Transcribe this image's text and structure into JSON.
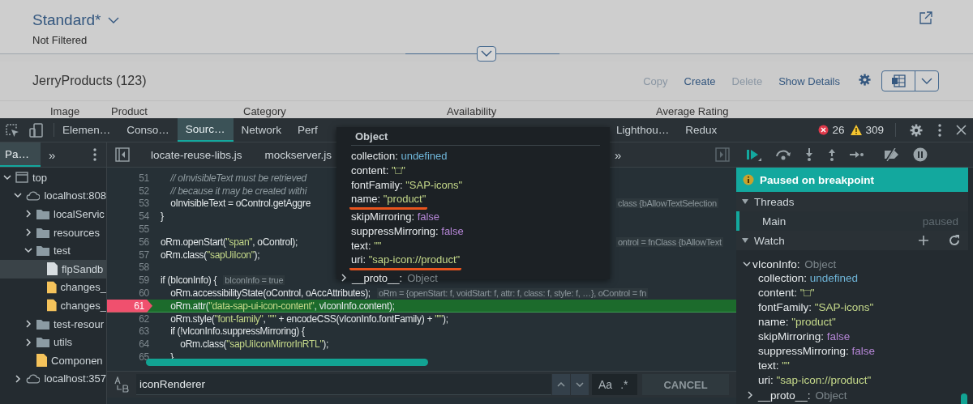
{
  "page": {
    "variant_title": "Standard*",
    "filter_status": "Not Filtered",
    "table_title": "JerryProducts (123)",
    "actions": [
      {
        "label": "Copy",
        "disabled": true
      },
      {
        "label": "Create",
        "disabled": false
      },
      {
        "label": "Delete",
        "disabled": true
      },
      {
        "label": "Show Details",
        "disabled": false
      }
    ],
    "columns": [
      "Image",
      "Product",
      "Category",
      "Availability",
      "Average Rating"
    ]
  },
  "devtools": {
    "tabs": [
      {
        "label": "Elemen…",
        "selected": false
      },
      {
        "label": "Conso…",
        "selected": false
      },
      {
        "label": "Sourc…",
        "selected": true
      },
      {
        "label": "Network",
        "selected": false
      },
      {
        "label": "Perf",
        "selected": false
      },
      {
        "label": "Lighthou…",
        "selected": false
      },
      {
        "label": "Redux",
        "selected": false
      }
    ],
    "errors": "26",
    "warnings": "309",
    "navigator": {
      "tab": {
        "label": "Pa…",
        "selected": true
      },
      "more": "»",
      "tree": [
        {
          "label": "top",
          "kind": "frame",
          "expanded": true,
          "selected": false,
          "children": [
            {
              "label": "localhost:808",
              "kind": "origin",
              "expanded": true,
              "selected": false,
              "children": [
                {
                  "label": "localServic",
                  "kind": "folder",
                  "expanded": false,
                  "selected": false
                },
                {
                  "label": "resources",
                  "kind": "folder",
                  "expanded": false,
                  "selected": false
                },
                {
                  "label": "test",
                  "kind": "folder",
                  "expanded": true,
                  "selected": false,
                  "children": [
                    {
                      "label": "flpSandb",
                      "kind": "file",
                      "selected": true
                    },
                    {
                      "label": "changes_",
                      "kind": "script",
                      "selected": false
                    },
                    {
                      "label": "changes_",
                      "kind": "script",
                      "selected": false
                    }
                  ]
                },
                {
                  "label": "test-resour",
                  "kind": "folder",
                  "expanded": false,
                  "selected": false
                },
                {
                  "label": "utils",
                  "kind": "folder",
                  "expanded": false,
                  "selected": false
                },
                {
                  "label": "Componen",
                  "kind": "script",
                  "selected": false
                }
              ]
            },
            {
              "label": "localhost:357",
              "kind": "origin",
              "expanded": false,
              "selected": false
            }
          ]
        }
      ]
    },
    "files": [
      "locate-reuse-libs.js",
      "mockserver.js"
    ],
    "files_more": "»",
    "code": [
      {
        "number": "51",
        "kind": "comment",
        "text": "    // oInvisibleText must be retrieved",
        "paused": false
      },
      {
        "number": "52",
        "kind": "comment",
        "text": "    // because it may be created withi",
        "paused": false
      },
      {
        "number": "53",
        "kind": "code",
        "text": "    oInvisibleText = oControl.getAggre",
        "hint": {
          "text": "class {bAllowTextSelection",
          "kind": "far"
        },
        "paused": false
      },
      {
        "number": "54",
        "kind": "code",
        "text": "}",
        "paused": false
      },
      {
        "number": "55",
        "paused": false
      },
      {
        "number": "56",
        "kind": "code",
        "text": "oRm.openStart(\"span\", oControl);",
        "hint": {
          "text": "ontrol = fnClass {bAllowText",
          "kind": "far"
        },
        "paused": false
      },
      {
        "number": "57",
        "kind": "code",
        "text": "oRm.class(\"sapUiIcon\");",
        "paused": false
      },
      {
        "number": "58",
        "paused": false
      },
      {
        "number": "59",
        "kind": "code",
        "text": "if (bIconInfo) {",
        "hint": {
          "text": "bIconInfo = true",
          "kind": "inline"
        },
        "paused": false
      },
      {
        "number": "60",
        "kind": "code",
        "text": "    oRm.accessibilityState(oControl, oAccAttributes);",
        "hint": {
          "text": "oRm = {openStart: f, voidStart: f, attr: f, class: f, style: f, …}, oControl = fn",
          "kind": "inline"
        },
        "paused": false
      },
      {
        "number": "61",
        "kind": "code",
        "text": "    oRm.attr(\"data-sap-ui-icon-content\", vIconInfo.content);",
        "paused": true
      },
      {
        "number": "62",
        "kind": "code",
        "text": "    oRm.style(\"font-family\", \"'\" + encodeCSS(vIconInfo.fontFamily) + \"'\");",
        "paused": false
      },
      {
        "number": "63",
        "kind": "code",
        "text": "    if (!vIconInfo.suppressMirroring) {",
        "paused": false
      },
      {
        "number": "64",
        "kind": "code",
        "text": "        oRm.class(\"sapUiIconMirrorInRTL\");",
        "paused": false
      },
      {
        "number": "65",
        "kind": "code",
        "text": "    }",
        "paused": false
      }
    ],
    "popup": {
      "title": "Object",
      "properties": [
        {
          "text": "collection: undefined",
          "kind": "undefined",
          "underlined": false
        },
        {
          "text": "content: \"□\"",
          "kind": "string",
          "underlined": false
        },
        {
          "text": "fontFamily: \"SAP-icons\"",
          "kind": "string",
          "underlined": false
        },
        {
          "text": "name: \"product\"",
          "kind": "string",
          "underlined": true
        },
        {
          "text": "skipMirroring: false",
          "kind": "boolean",
          "underlined": false
        },
        {
          "text": "suppressMirroring: false",
          "kind": "boolean",
          "underlined": false
        },
        {
          "text": "text: \"\"",
          "kind": "string",
          "underlined": false
        },
        {
          "text": "uri: \"sap-icon://product\"",
          "kind": "string",
          "underlined": true
        }
      ],
      "proto": "__proto__: Object"
    },
    "search": {
      "query": "iconRenderer",
      "match_case": "Aa",
      "regex": ".*",
      "cancel": "CANCEL"
    },
    "debugger": {
      "banner": "Paused on breakpoint",
      "threads": {
        "title": "Threads",
        "expanded": true,
        "items": [
          {
            "name": "Main",
            "status": "paused",
            "selected": true
          }
        ]
      },
      "watch": {
        "title": "Watch",
        "expanded": true,
        "expression": {
          "text": "vIconInfo: Object",
          "expanded": true,
          "properties": [
            {
              "text": "collection: undefined",
              "kind": "undefined"
            },
            {
              "text": "content: \"□\"",
              "kind": "string"
            },
            {
              "text": "fontFamily: \"SAP-icons\"",
              "kind": "string"
            },
            {
              "text": "name: \"product\"",
              "kind": "string"
            },
            {
              "text": "skipMirroring: false",
              "kind": "boolean"
            },
            {
              "text": "suppressMirroring: false",
              "kind": "boolean"
            },
            {
              "text": "text: \"\"",
              "kind": "string"
            },
            {
              "text": "uri: \"sap-icon://product\"",
              "kind": "string"
            }
          ],
          "proto": "__proto__: Object"
        }
      }
    }
  }
}
